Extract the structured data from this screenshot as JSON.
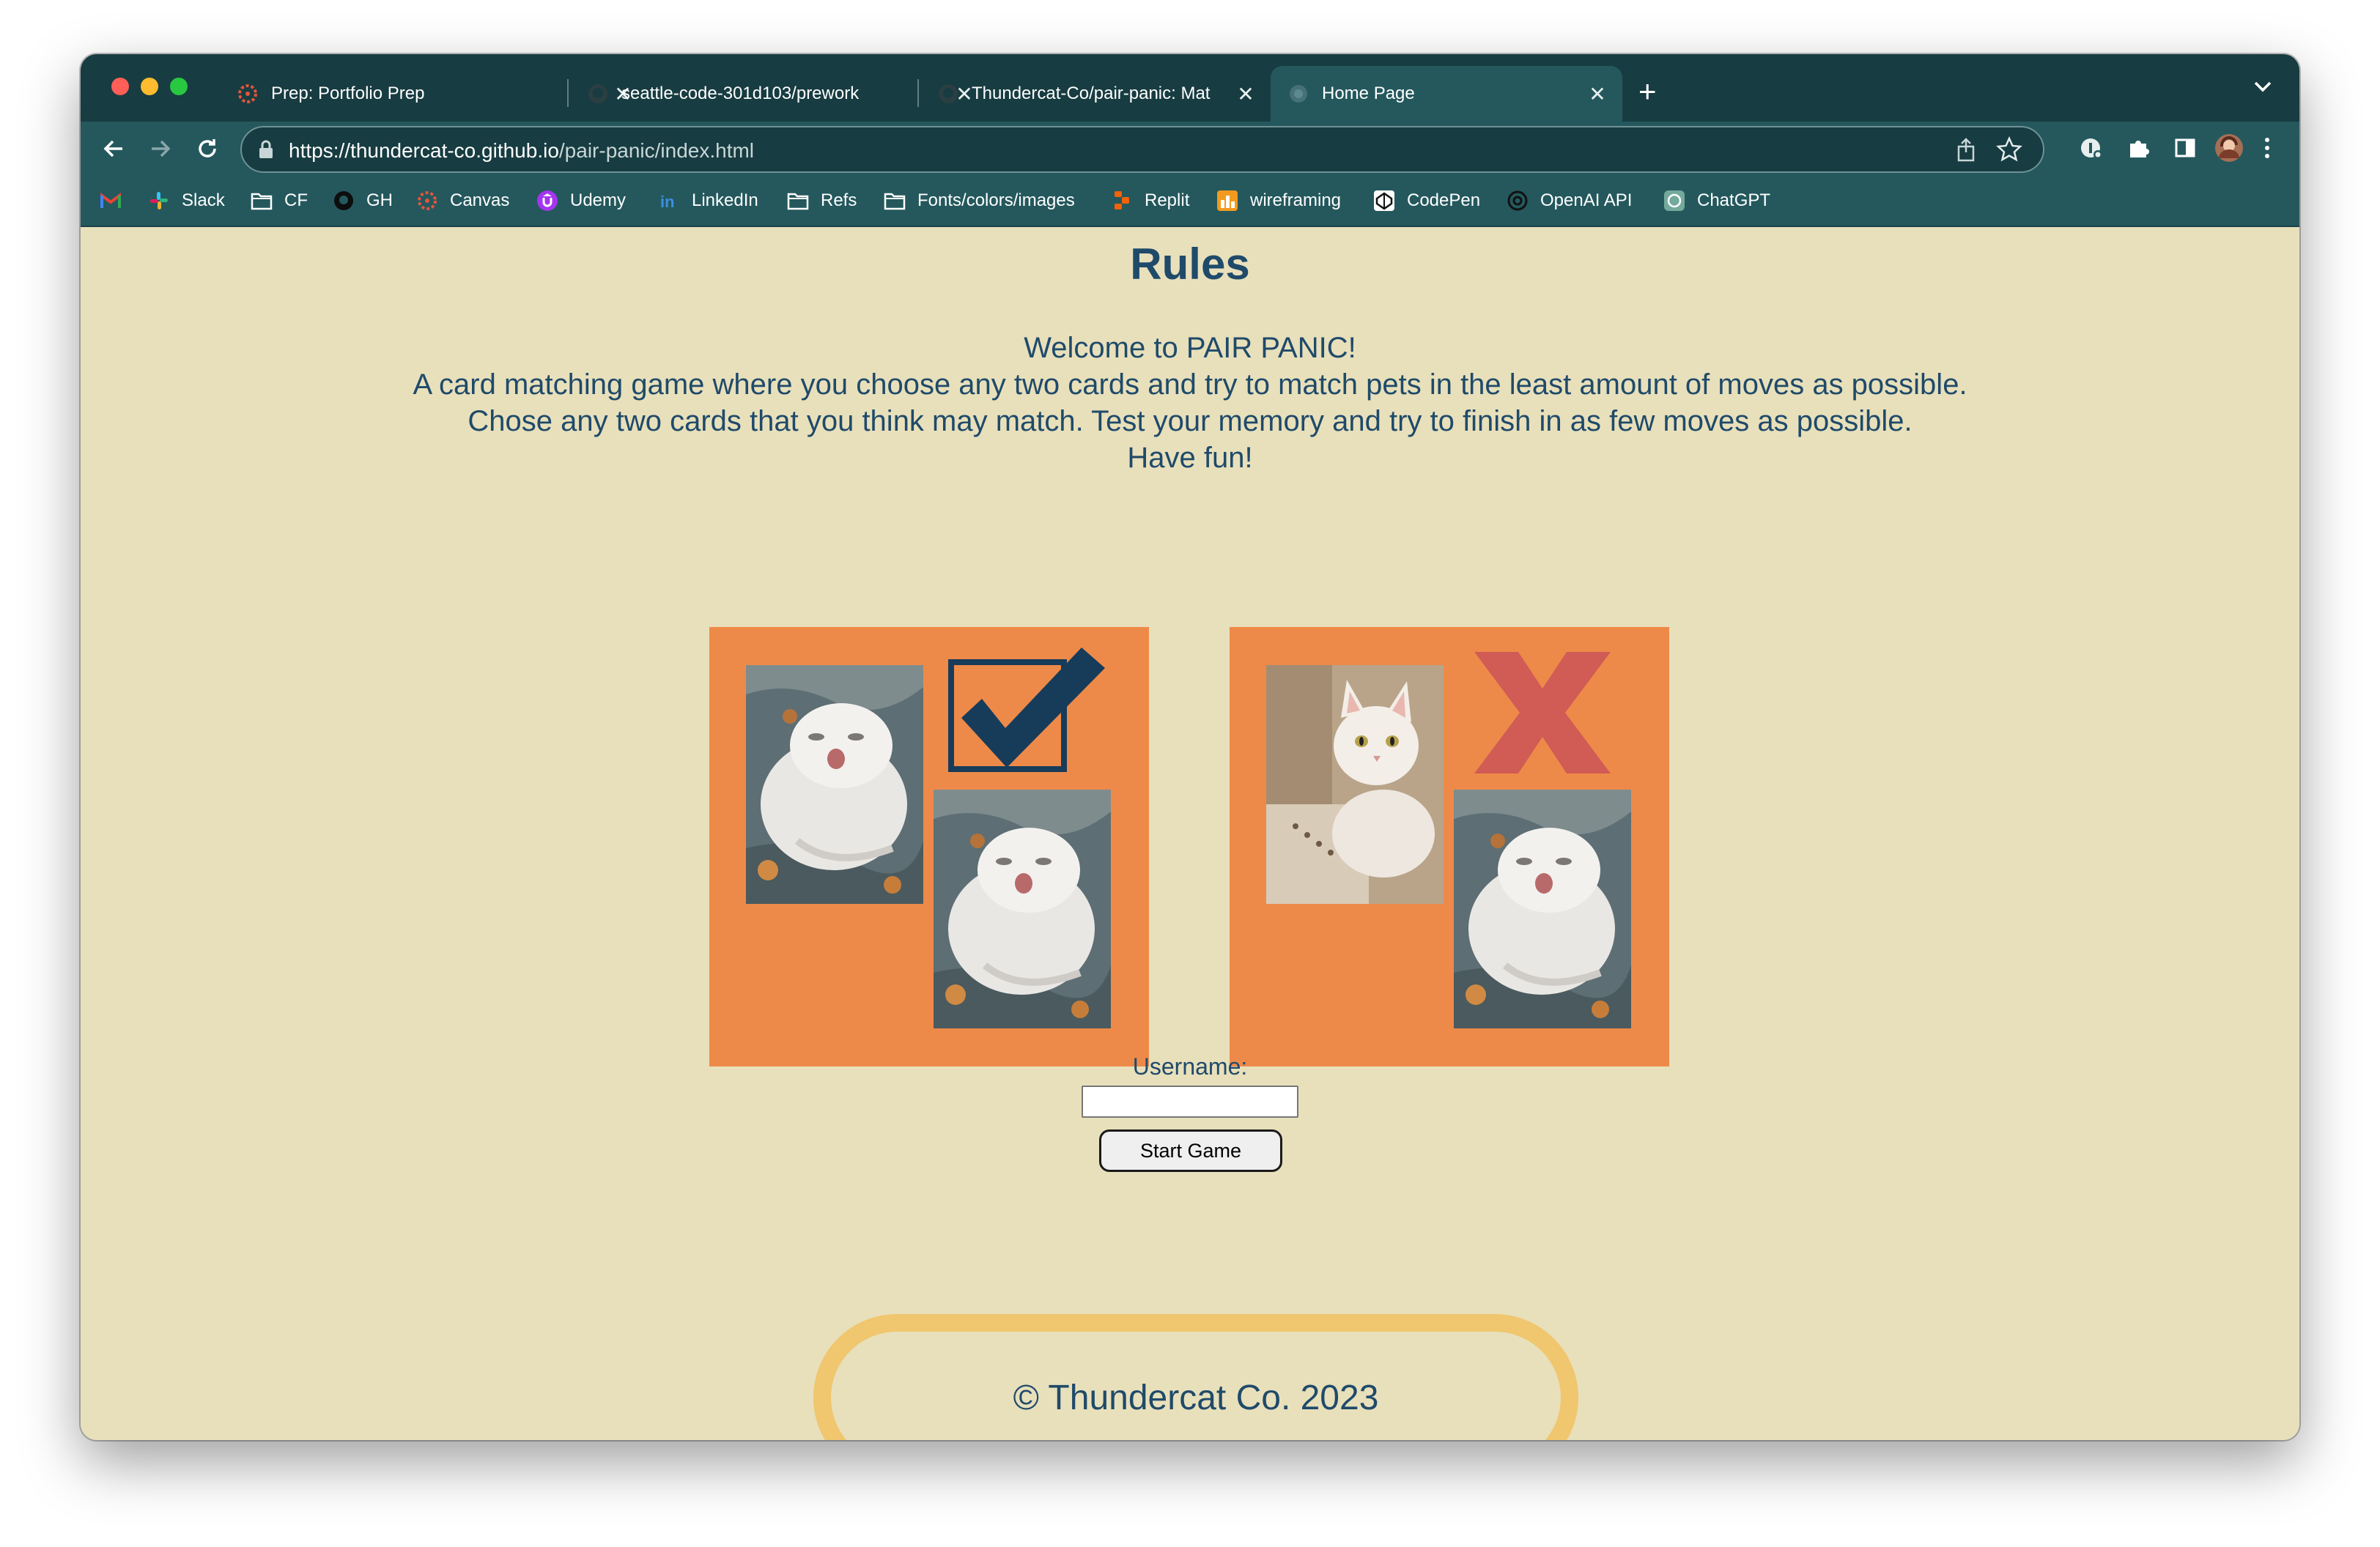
{
  "tabs": [
    {
      "title": "Prep: Portfolio Prep",
      "favicon": "canvas-icon",
      "active": false
    },
    {
      "title": "seattle-code-301d103/prework",
      "favicon": "github-icon",
      "active": false
    },
    {
      "title": "Thundercat-Co/pair-panic: Mat",
      "favicon": "github-icon",
      "active": false
    },
    {
      "title": "Home Page",
      "favicon": "globe-icon",
      "active": true
    }
  ],
  "toolbar": {
    "url_host": "https://thundercat-co.github.io",
    "url_path": "/pair-panic/index.html"
  },
  "bookmarks": [
    {
      "label": "",
      "icon": "gmail-icon"
    },
    {
      "label": "Slack",
      "icon": "slack-icon"
    },
    {
      "label": "CF",
      "icon": "folder-icon"
    },
    {
      "label": "GH",
      "icon": "github-icon"
    },
    {
      "label": "Canvas",
      "icon": "canvas-icon"
    },
    {
      "label": "Udemy",
      "icon": "udemy-icon"
    },
    {
      "label": "LinkedIn",
      "icon": "linkedin-icon"
    },
    {
      "label": "Refs",
      "icon": "folder-icon"
    },
    {
      "label": "Fonts/colors/images",
      "icon": "folder-icon"
    },
    {
      "label": "Replit",
      "icon": "replit-icon"
    },
    {
      "label": "wireframing",
      "icon": "wireframing-icon"
    },
    {
      "label": "CodePen",
      "icon": "codepen-icon"
    },
    {
      "label": "OpenAI API",
      "icon": "openai-icon"
    },
    {
      "label": "ChatGPT",
      "icon": "chatgpt-icon"
    }
  ],
  "page": {
    "heading": "Rules",
    "rules_lines": [
      "Welcome to PAIR PANIC!",
      "A card matching game where you choose any two cards and try to match pets in the least amount of moves as possible.",
      "Chose any two cards that you think may match. Test your memory and try to finish in as few moves as possible.",
      "Have fun!"
    ],
    "username_label": "Username:",
    "username_value": "",
    "start_button": "Start Game",
    "footer": "© Thundercat Co. 2023"
  },
  "colors": {
    "tabstrip": "#173c41",
    "toolbar": "#24585d",
    "page_bg": "#e8e0bb",
    "text": "#1f4a6a",
    "card": "#ee8a49",
    "check": "#173c5a",
    "cross": "#d15b55",
    "footer_border": "#f0c66e"
  }
}
